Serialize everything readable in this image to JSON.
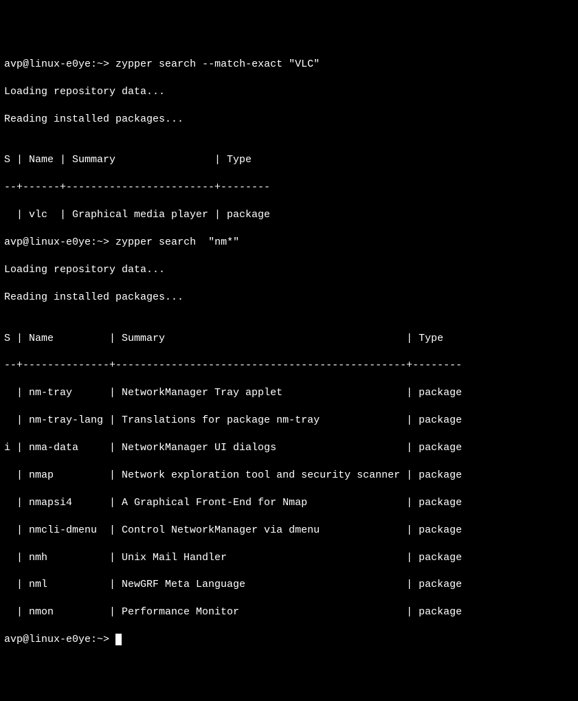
{
  "prompt1": {
    "user_host": "avp@linux-e0ye",
    "sep": ":~>",
    "command": " zypper search --match-exact \"VLC\""
  },
  "loading": "Loading repository data...",
  "reading": "Reading installed packages...",
  "blank": "",
  "table1": {
    "header": "S | Name | Summary                | Type",
    "divider": "--+------+------------------------+--------",
    "row": "  | vlc  | Graphical media player | package"
  },
  "prompt2": {
    "user_host": "avp@linux-e0ye",
    "sep": ":~>",
    "command": " zypper search  \"nm*\""
  },
  "table2": {
    "header": "S | Name         | Summary                                       | Type",
    "divider": "--+--------------+-----------------------------------------------+--------",
    "rows": [
      "  | nm-tray      | NetworkManager Tray applet                    | package",
      "  | nm-tray-lang | Translations for package nm-tray              | package",
      "i | nma-data     | NetworkManager UI dialogs                     | package",
      "  | nmap         | Network exploration tool and security scanner | package",
      "  | nmapsi4      | A Graphical Front-End for Nmap                | package",
      "  | nmcli-dmenu  | Control NetworkManager via dmenu              | package",
      "  | nmh          | Unix Mail Handler                             | package",
      "  | nml          | NewGRF Meta Language                          | package",
      "  | nmon         | Performance Monitor                           | package"
    ]
  },
  "prompt3": {
    "user_host": "avp@linux-e0ye",
    "sep": ":~>",
    "command": " "
  }
}
